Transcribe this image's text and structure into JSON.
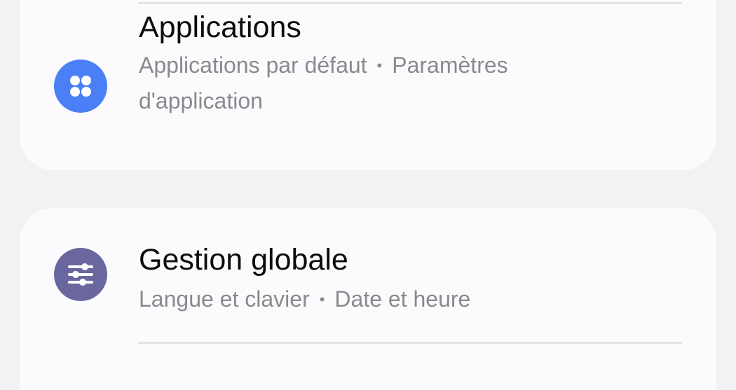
{
  "colors": {
    "apps_icon_bg": "#4a7ff5",
    "management_icon_bg": "#6a679f",
    "card_bg": "#fbfbfd",
    "page_bg": "#f2f2f4"
  },
  "settings": [
    {
      "icon": "apps-grid-icon",
      "title": "Applications",
      "subtitle_parts": [
        "Applications par défaut",
        "Paramètres d'application"
      ],
      "separator": "•"
    },
    {
      "icon": "sliders-icon",
      "title": "Gestion globale",
      "subtitle_parts": [
        "Langue et clavier",
        "Date et heure"
      ],
      "separator": "•"
    }
  ]
}
